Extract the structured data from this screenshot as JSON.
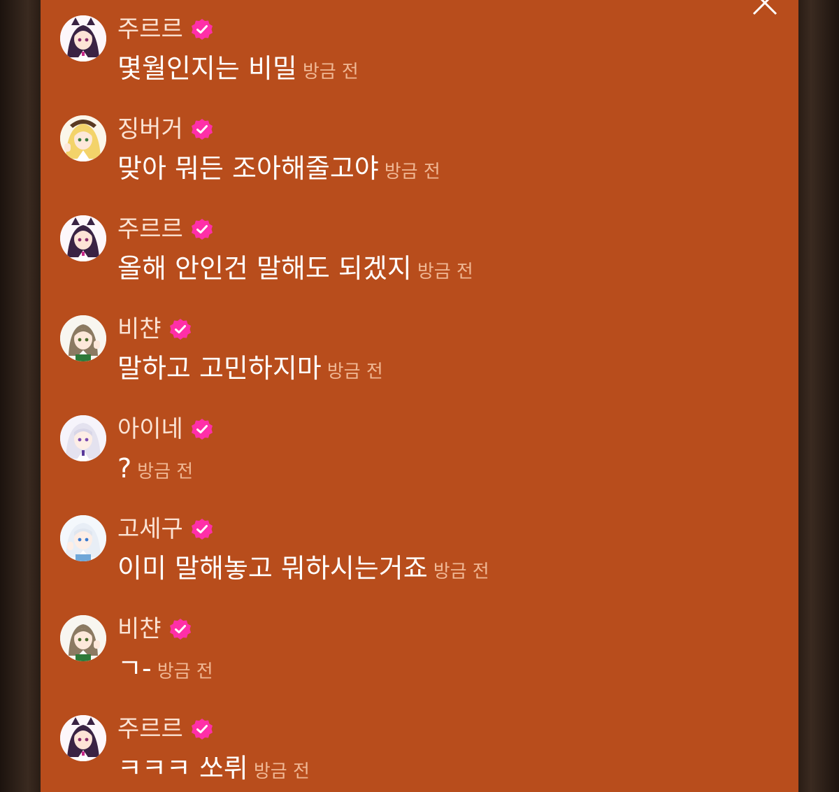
{
  "close_icon": "close-icon",
  "verified_icon": "verified-badge-icon",
  "accent_color": "#ff2fa8",
  "panel_color": "#b84d1c",
  "messages": [
    {
      "username": "주르르",
      "text": "몇월인지는 비밀",
      "time": "방금 전",
      "avatar": "avatar-jururu"
    },
    {
      "username": "징버거",
      "text": "맞아 뭐든 조아해줄고야",
      "time": "방금 전",
      "avatar": "avatar-jingburger"
    },
    {
      "username": "주르르",
      "text": "올해 안인건 말해도 되겠지",
      "time": "방금 전",
      "avatar": "avatar-jururu"
    },
    {
      "username": "비챤",
      "text": "말하고 고민하지마",
      "time": "방금 전",
      "avatar": "avatar-viichan"
    },
    {
      "username": "아이네",
      "text": "?",
      "time": "방금 전",
      "avatar": "avatar-ine"
    },
    {
      "username": "고세구",
      "text": "이미 말해놓고 뭐하시는거죠",
      "time": "방금 전",
      "avatar": "avatar-gosegu"
    },
    {
      "username": "비챤",
      "text": "ㄱ-",
      "time": "방금 전",
      "avatar": "avatar-viichan"
    },
    {
      "username": "주르르",
      "text": "ㅋㅋㅋ 쏘뤼",
      "time": "방금 전",
      "avatar": "avatar-jururu"
    }
  ]
}
